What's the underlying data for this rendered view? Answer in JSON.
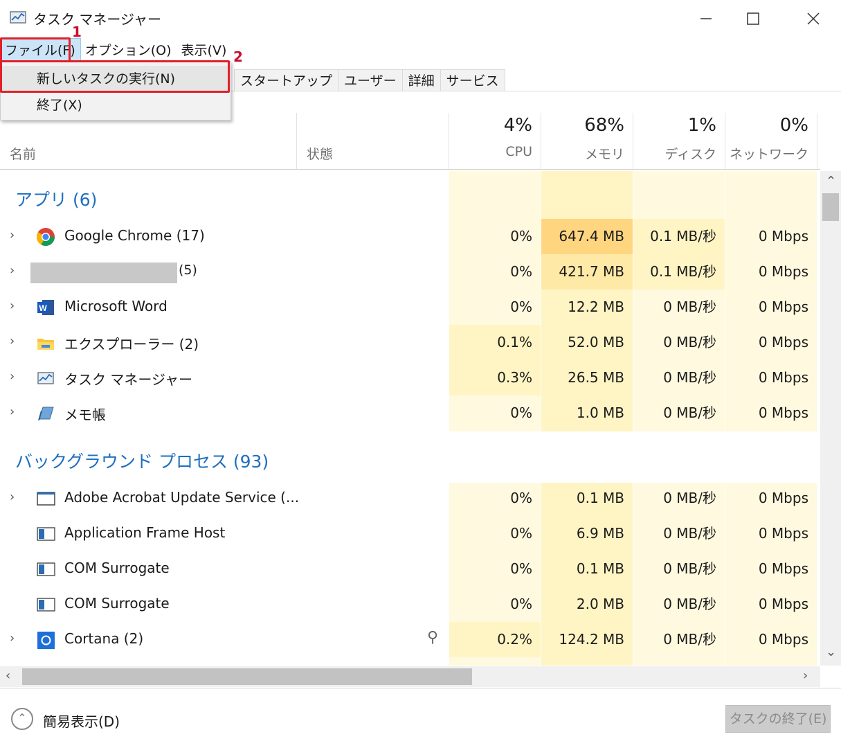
{
  "window": {
    "title": "タスク マネージャー"
  },
  "menu": [
    {
      "label": "ファイル(F)"
    },
    {
      "label": "オプション(O)"
    },
    {
      "label": "表示(V)"
    }
  ],
  "file_menu": {
    "items": [
      {
        "label": "新しいタスクの実行(N)"
      },
      {
        "label": "終了(X)"
      }
    ]
  },
  "annotations": {
    "step1": "1",
    "step2": "2"
  },
  "tabs": [
    {
      "label": "スタートアップ"
    },
    {
      "label": "ユーザー"
    },
    {
      "label": "詳細"
    },
    {
      "label": "サービス"
    }
  ],
  "columns": {
    "name": "名前",
    "status": "状態",
    "cpu": {
      "pct": "4%",
      "label": "CPU"
    },
    "memory": {
      "pct": "68%",
      "label": "メモリ"
    },
    "disk": {
      "pct": "1%",
      "label": "ディスク"
    },
    "network": {
      "pct": "0%",
      "label": "ネットワーク"
    }
  },
  "groups": {
    "apps": "アプリ (6)",
    "background": "バックグラウンド プロセス (93)"
  },
  "apps": [
    {
      "name": "Google Chrome (17)",
      "icon": "chrome-icon",
      "cpu": "0%",
      "mem": "647.4 MB",
      "disk": "0.1 MB/秒",
      "net": "0 Mbps"
    },
    {
      "name": "(5)",
      "icon": "redacted",
      "cpu": "0%",
      "mem": "421.7 MB",
      "disk": "0.1 MB/秒",
      "net": "0 Mbps"
    },
    {
      "name": "Microsoft Word",
      "icon": "word-icon",
      "cpu": "0%",
      "mem": "12.2 MB",
      "disk": "0 MB/秒",
      "net": "0 Mbps"
    },
    {
      "name": "エクスプローラー (2)",
      "icon": "folder-icon",
      "cpu": "0.1%",
      "mem": "52.0 MB",
      "disk": "0 MB/秒",
      "net": "0 Mbps"
    },
    {
      "name": "タスク マネージャー",
      "icon": "task-manager-icon",
      "cpu": "0.3%",
      "mem": "26.5 MB",
      "disk": "0 MB/秒",
      "net": "0 Mbps"
    },
    {
      "name": "メモ帳",
      "icon": "notepad-icon",
      "cpu": "0%",
      "mem": "1.0 MB",
      "disk": "0 MB/秒",
      "net": "0 Mbps"
    }
  ],
  "background": [
    {
      "name": "Adobe Acrobat Update Service (...",
      "icon": "window-icon",
      "cpu": "0%",
      "mem": "0.1 MB",
      "disk": "0 MB/秒",
      "net": "0 Mbps"
    },
    {
      "name": "Application Frame Host",
      "icon": "app-frame-icon",
      "cpu": "0%",
      "mem": "6.9 MB",
      "disk": "0 MB/秒",
      "net": "0 Mbps"
    },
    {
      "name": "COM Surrogate",
      "icon": "app-frame-icon",
      "cpu": "0%",
      "mem": "0.1 MB",
      "disk": "0 MB/秒",
      "net": "0 Mbps"
    },
    {
      "name": "COM Surrogate",
      "icon": "app-frame-icon",
      "cpu": "0%",
      "mem": "2.0 MB",
      "disk": "0 MB/秒",
      "net": "0 Mbps"
    },
    {
      "name": "Cortana (2)",
      "icon": "cortana-icon",
      "cpu": "0.2%",
      "mem": "124.2 MB",
      "disk": "0 MB/秒",
      "net": "0 Mbps"
    }
  ],
  "footer": {
    "fewer_details": "簡易表示(D)",
    "end_task": "タスクの終了(E)"
  },
  "colors": {
    "accent_blue": "#1e6fbf",
    "highlight_red": "#e0202a",
    "heat_light": "#fff4c4",
    "heat_mid": "#ffe9a6",
    "heat_strong": "#ffd580"
  }
}
